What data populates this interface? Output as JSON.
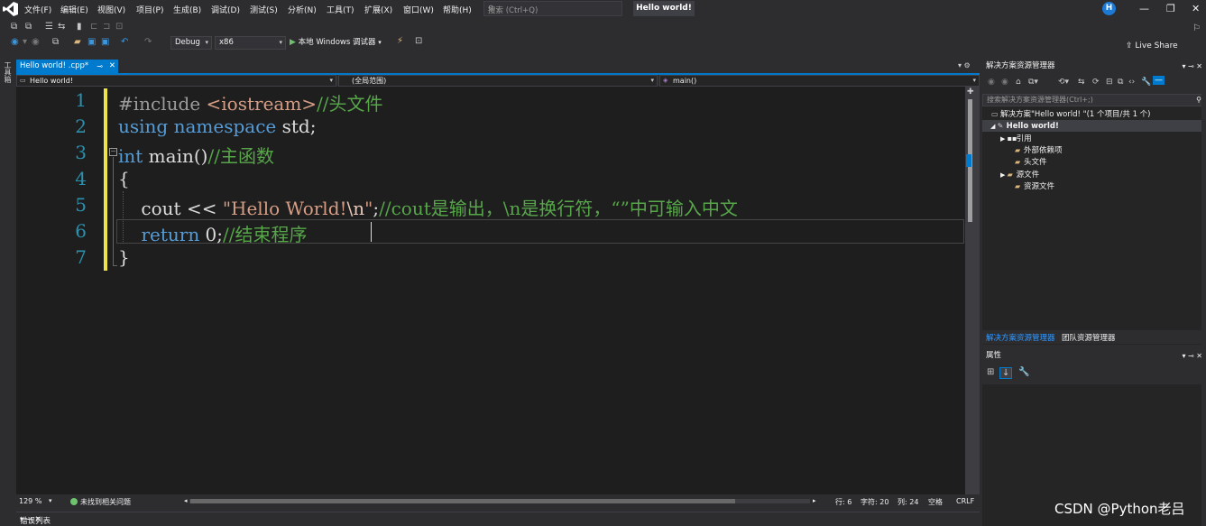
{
  "menu": [
    "文件(F)",
    "编辑(E)",
    "视图(V)",
    "项目(P)",
    "生成(B)",
    "调试(D)",
    "测试(S)",
    "分析(N)",
    "工具(T)",
    "扩展(X)",
    "窗口(W)",
    "帮助(H)"
  ],
  "search": {
    "placeholder": "搜索 (Ctrl+Q)"
  },
  "window_title": "Hello world!",
  "user_initial": "H",
  "toolbar": {
    "config": "Debug",
    "platform": "x86",
    "run_label": "本地 Windows 调试器",
    "live_share": "Live Share"
  },
  "left_strip_label": "工具箱",
  "doc_tab": {
    "label": "Hello world! .cpp*"
  },
  "nav": {
    "project": "Hello world!",
    "scope": "(全局范围)",
    "member": "main()"
  },
  "code": {
    "line_numbers": [
      "1",
      "2",
      "3",
      "4",
      "5",
      "6",
      "7"
    ],
    "l1_kw": "#include",
    "l1_inc": " <iostream>",
    "l1_cm": "//头文件",
    "l2_kw1": "using",
    "l2_sp": " ",
    "l2_kw2": "namespace",
    "l2_rest": " std;",
    "l3_kw": "int",
    "l3_rest": " main()",
    "l3_cm": "//主函数",
    "l4": "{",
    "l5_a": "    cout << ",
    "l5_str1": "\"Hello World!",
    "l5_esc": "\\n",
    "l5_str2": "\"",
    "l5_semi": ";",
    "l5_cm": "//cout是输出，\\n是换行符，“”中可输入中文",
    "l6_ind": "    ",
    "l6_kw": "return",
    "l6_rest": " 0;",
    "l6_cm": "//结束程序",
    "l7": "}"
  },
  "status": {
    "zoom": "129 %",
    "issues": "未找到相关问题",
    "line": "行: 6",
    "char": "字符: 20",
    "col": "列: 24",
    "ws": "空格",
    "eol": "CRLF"
  },
  "bottom": {
    "error_list": "错误列表"
  },
  "solution_explorer": {
    "title": "解决方案资源管理器",
    "search_placeholder": "搜索解决方案资源管理器(Ctrl+;)",
    "solution_node": "解决方案\"Hello world! \"(1 个项目/共 1 个)",
    "project_node": "Hello world!",
    "items": [
      "引用",
      "外部依赖项",
      "头文件",
      "源文件",
      "资源文件"
    ],
    "tab_active": "解决方案资源管理器",
    "tab_other": "团队资源管理器"
  },
  "properties": {
    "title": "属性"
  },
  "watermark": "CSDN @Python老吕",
  "colors": {
    "accent": "#007acc",
    "keyword": "#569cd6",
    "comment": "#57a64a",
    "string": "#d69d85",
    "line_number": "#2b91af"
  }
}
